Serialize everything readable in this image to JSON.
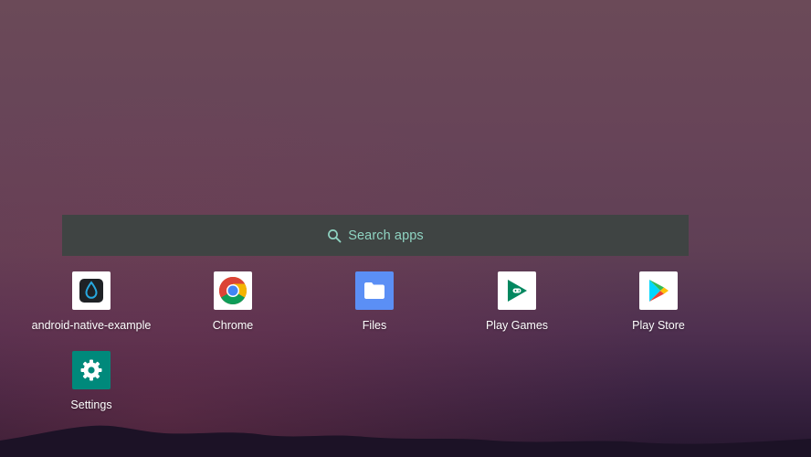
{
  "search": {
    "label": "Search apps",
    "icon": "search-icon",
    "accent": "#8fd4c2"
  },
  "apps": [
    {
      "label": "android-native-example",
      "icon": "drop-icon"
    },
    {
      "label": "Chrome",
      "icon": "chrome-icon"
    },
    {
      "label": "Files",
      "icon": "folder-icon"
    },
    {
      "label": "Play Games",
      "icon": "play-games-icon"
    },
    {
      "label": "Play Store",
      "icon": "play-store-icon"
    },
    {
      "label": "Settings",
      "icon": "gear-icon"
    }
  ],
  "colors": {
    "search_bar": "#3f4443",
    "files_tile": "#5b8ff5",
    "settings_tile": "#00897b"
  }
}
